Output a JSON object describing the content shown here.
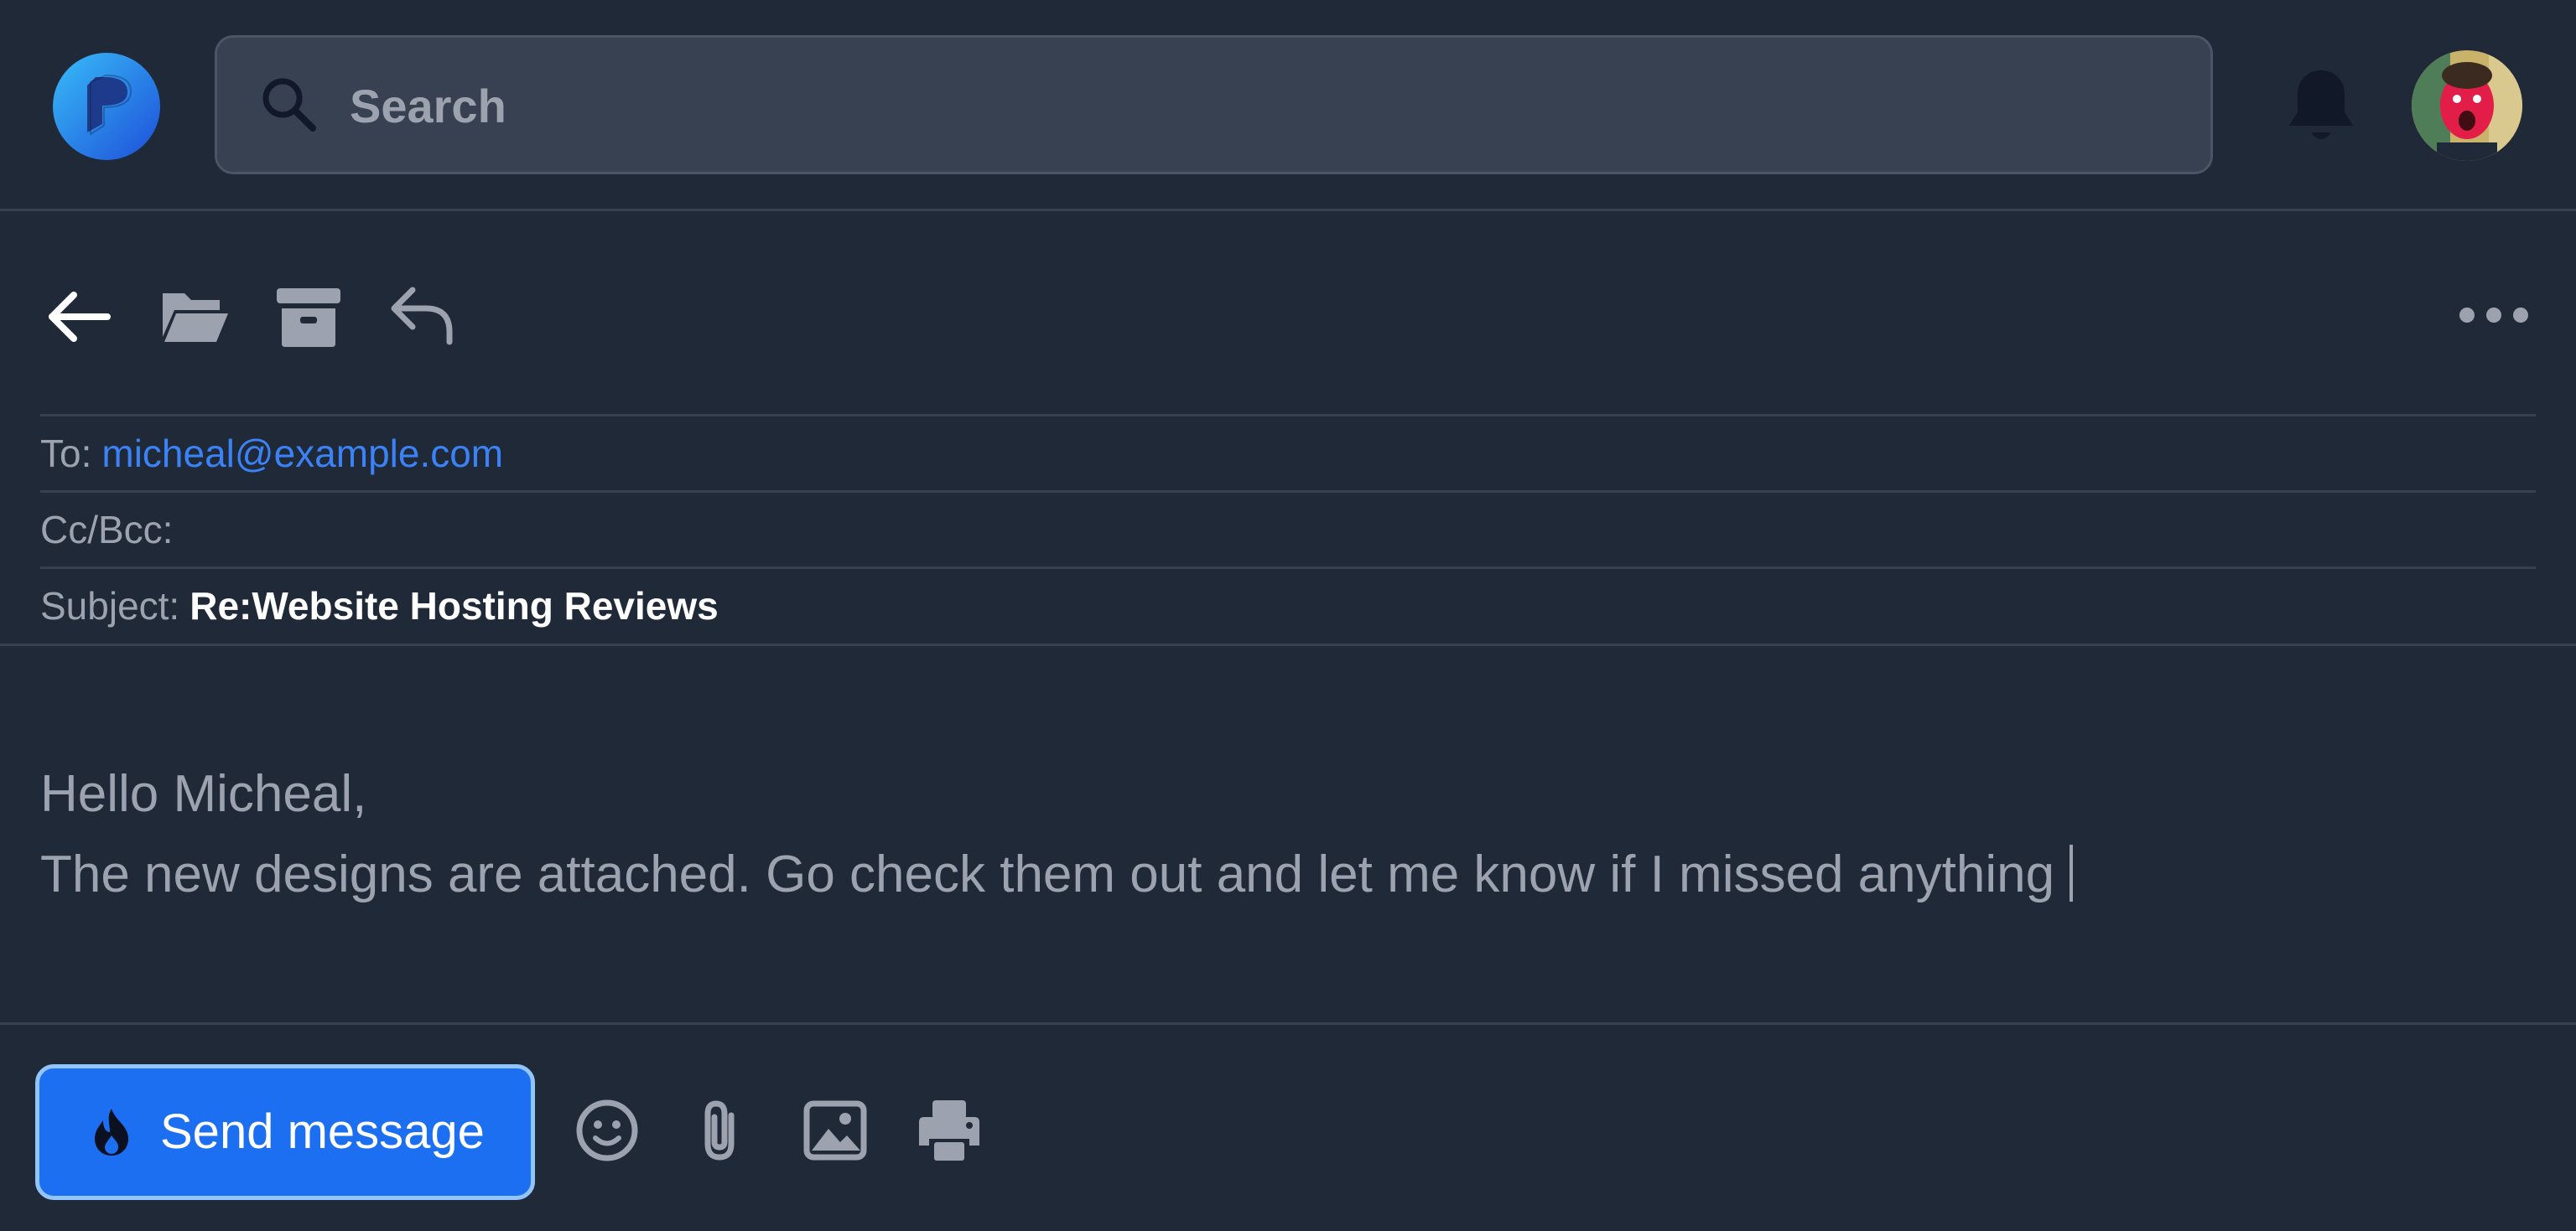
{
  "search": {
    "placeholder": "Search"
  },
  "header_fields": {
    "to_label": "To:",
    "to_value": "micheal@example.com",
    "cc_label": "Cc/Bcc:",
    "subject_label": "Subject:",
    "subject_value": "Re:Website Hosting Reviews"
  },
  "message": {
    "greeting": "Hello Micheal,",
    "body": "The new designs are attached. Go check them out and let me know if I missed anything"
  },
  "footer": {
    "send_label": "Send message"
  },
  "icons": {
    "logo": "app-logo",
    "search": "search-icon",
    "notifications": "bell-icon",
    "back": "arrow-left-icon",
    "move": "folder-icon",
    "archive": "archive-icon",
    "reply": "reply-icon",
    "more": "more-horizontal-icon",
    "send": "fire-icon",
    "emoji": "emoji-icon",
    "attach": "paperclip-icon",
    "image": "image-icon",
    "print": "printer-icon"
  },
  "colors": {
    "background": "#1f2937",
    "accent": "#1d6ff2",
    "link": "#3b82f6",
    "muted_text": "#9ca3af",
    "divider": "#374151"
  }
}
